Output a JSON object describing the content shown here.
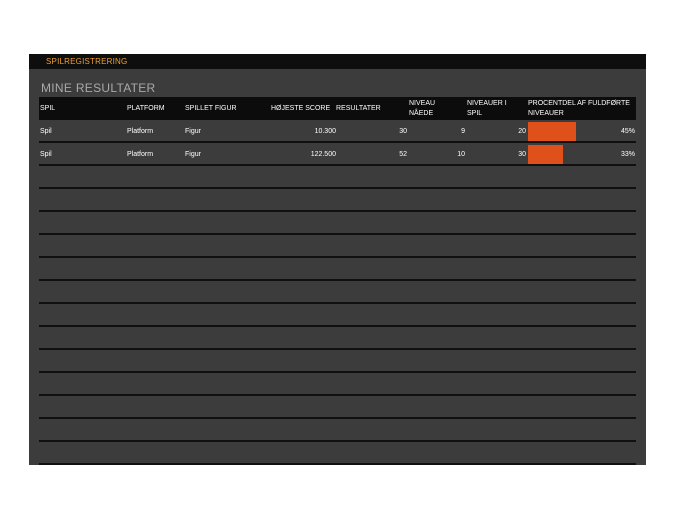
{
  "banner": {
    "title": "SPILREGISTRERING"
  },
  "section_title": "MINE RESULTATER",
  "columns": {
    "spil": "SPIL",
    "platform": "PLATFORM",
    "figur": "SPILLET FIGUR",
    "score": "HØJESTE SCORE",
    "resultater": "RESULTATER",
    "niveau_line1": "NIVEAU",
    "niveau_line2": "NÅEDE",
    "niveauer_line1": "NIVEAUER I",
    "niveauer_line2": "SPIL",
    "procent_line1": "PROCENTDEL AF FULDFØRTE",
    "procent_line2": "NIVEAUER"
  },
  "rows": [
    {
      "spil": "Spil",
      "platform": "Platform",
      "figur": "Figur",
      "score": "10.300",
      "resultater": "30",
      "niveau": "9",
      "niveauer": "20",
      "procent_text": "45%",
      "procent": 0.45
    },
    {
      "spil": "Spil",
      "platform": "Platform",
      "figur": "Figur",
      "score": "122.500",
      "resultater": "52",
      "niveau": "10",
      "niveauer": "30",
      "procent_text": "33%",
      "procent": 0.33
    }
  ],
  "colors": {
    "bar": "#e0501a",
    "banner_text": "#f0a030",
    "sheet_bg": "#3c3c3c"
  }
}
